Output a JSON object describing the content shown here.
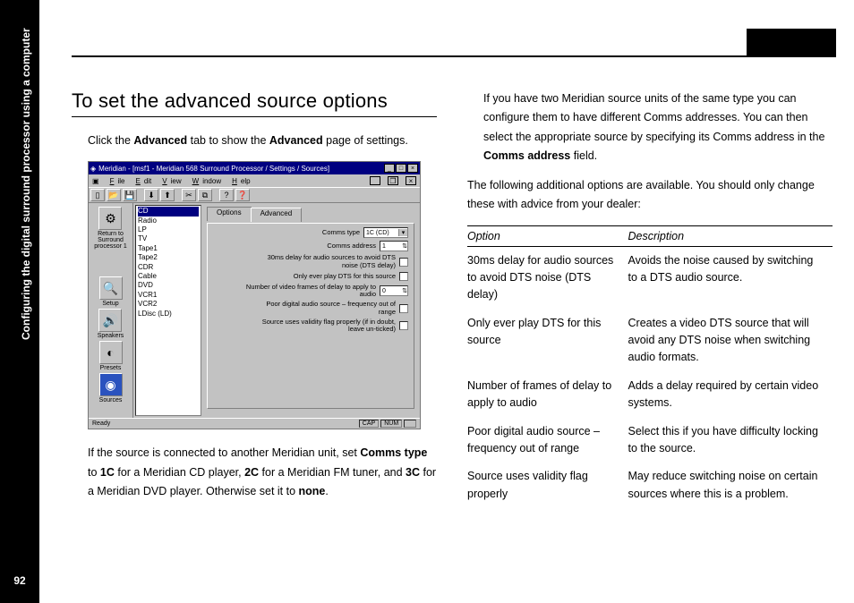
{
  "pageNumber": "92",
  "sidebarCaption": "Configuring the digital surround processor using a computer",
  "heading": "To set the advanced source options",
  "leftCol": {
    "p1_a": "Click the ",
    "p1_b": "Advanced",
    "p1_c": " tab to show the ",
    "p1_d": "Advanced",
    "p1_e": " page of settings.",
    "p2_a": "If the source is connected to another Meridian unit, set ",
    "p2_b": "Comms type",
    "p2_c": " to ",
    "p2_d": "1C",
    "p2_e": " for a Meridian CD player, ",
    "p2_f": "2C",
    "p2_g": " for a Meridian FM tuner, and ",
    "p2_h": "3C",
    "p2_i": " for a Meridian DVD player. Otherwise set it to ",
    "p2_j": "none",
    "p2_k": "."
  },
  "rightCol": {
    "p1_a": "If you have two Meridian source units of the same type you can configure them to have different Comms addresses. You can then select the appropriate source by specifying its Comms address in the ",
    "p1_b": "Comms address",
    "p1_c": " field.",
    "p2": "The following additional options are available. You should only change these with advice from your dealer:"
  },
  "table": {
    "h1": "Option",
    "h2": "Description",
    "rows": [
      {
        "opt": "30ms delay for audio sources to avoid DTS noise (DTS delay)",
        "desc": "Avoids the noise caused by switching to a DTS audio source."
      },
      {
        "opt": "Only ever play DTS for this source",
        "desc": "Creates a video DTS source that will avoid any DTS noise when switching audio formats."
      },
      {
        "opt": "Number of frames of delay to apply to audio",
        "desc": "Adds a delay required by certain video systems."
      },
      {
        "opt": "Poor digital audio source – frequency out of range",
        "desc": "Select this if you have difficulty locking to the source."
      },
      {
        "opt": "Source uses validity flag properly",
        "desc": "May reduce switching noise on certain sources where this is a problem."
      }
    ]
  },
  "shot": {
    "title": "Meridian - [msf1 - Meridian 568 Surround Processor / Settings / Sources]",
    "menus": {
      "file": "File",
      "edit": "Edit",
      "view": "View",
      "window": "Window",
      "help": "Help"
    },
    "sidebar": {
      "return_l1": "Return to",
      "return_l2": "Surround",
      "return_l3": "processor 1",
      "setup": "Setup",
      "speakers": "Speakers",
      "presets": "Presets",
      "sources": "Sources"
    },
    "sources": [
      "CD",
      "Radio",
      "LP",
      "TV",
      "Tape1",
      "Tape2",
      "CDR",
      "Cable",
      "DVD",
      "VCR1",
      "VCR2",
      "LDisc (LD)"
    ],
    "tabs": {
      "options": "Options",
      "advanced": "Advanced"
    },
    "form": {
      "commsType_lbl": "Comms type",
      "commsType_val": "1C (CD)",
      "commsAddr_lbl": "Comms address",
      "commsAddr_val": "1",
      "dtsDelay_lbl": "30ms delay for audio sources to avoid DTS noise (DTS delay)",
      "onlyDts_lbl": "Only ever play DTS for this source",
      "frames_lbl": "Number of video frames of delay to apply to audio",
      "frames_val": "0",
      "poor_lbl": "Poor digital audio source – frequency out of range",
      "validity_lbl": "Source uses validity flag properly (if in doubt, leave un-ticked)"
    },
    "status": {
      "ready": "Ready",
      "cap": "CAP",
      "num": "NUM"
    }
  }
}
